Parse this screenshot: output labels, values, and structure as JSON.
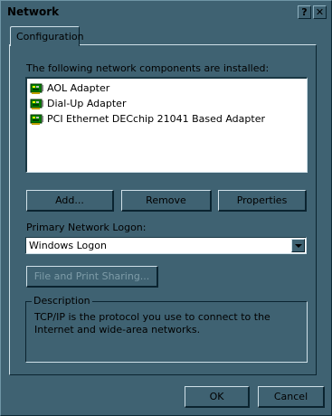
{
  "window": {
    "title": "Network",
    "help_label": "?",
    "close_label": "✕"
  },
  "tabs": [
    {
      "label": "Configuration"
    }
  ],
  "components": {
    "heading": "The following network components are installed:",
    "items": [
      {
        "label": "AOL Adapter",
        "icon": "network-adapter-icon"
      },
      {
        "label": "Dial-Up Adapter",
        "icon": "network-adapter-icon"
      },
      {
        "label": "PCI Ethernet DECchip 21041 Based Adapter",
        "icon": "network-adapter-icon"
      }
    ]
  },
  "buttons": {
    "add": "Add...",
    "remove": "Remove",
    "properties": "Properties",
    "file_print_sharing": "File and Print Sharing...",
    "ok": "OK",
    "cancel": "Cancel"
  },
  "logon": {
    "label": "Primary Network Logon:",
    "value": "Windows Logon"
  },
  "description": {
    "title": "Description",
    "text": "TCP/IP is the protocol you use to connect to the Internet and wide-area networks."
  }
}
